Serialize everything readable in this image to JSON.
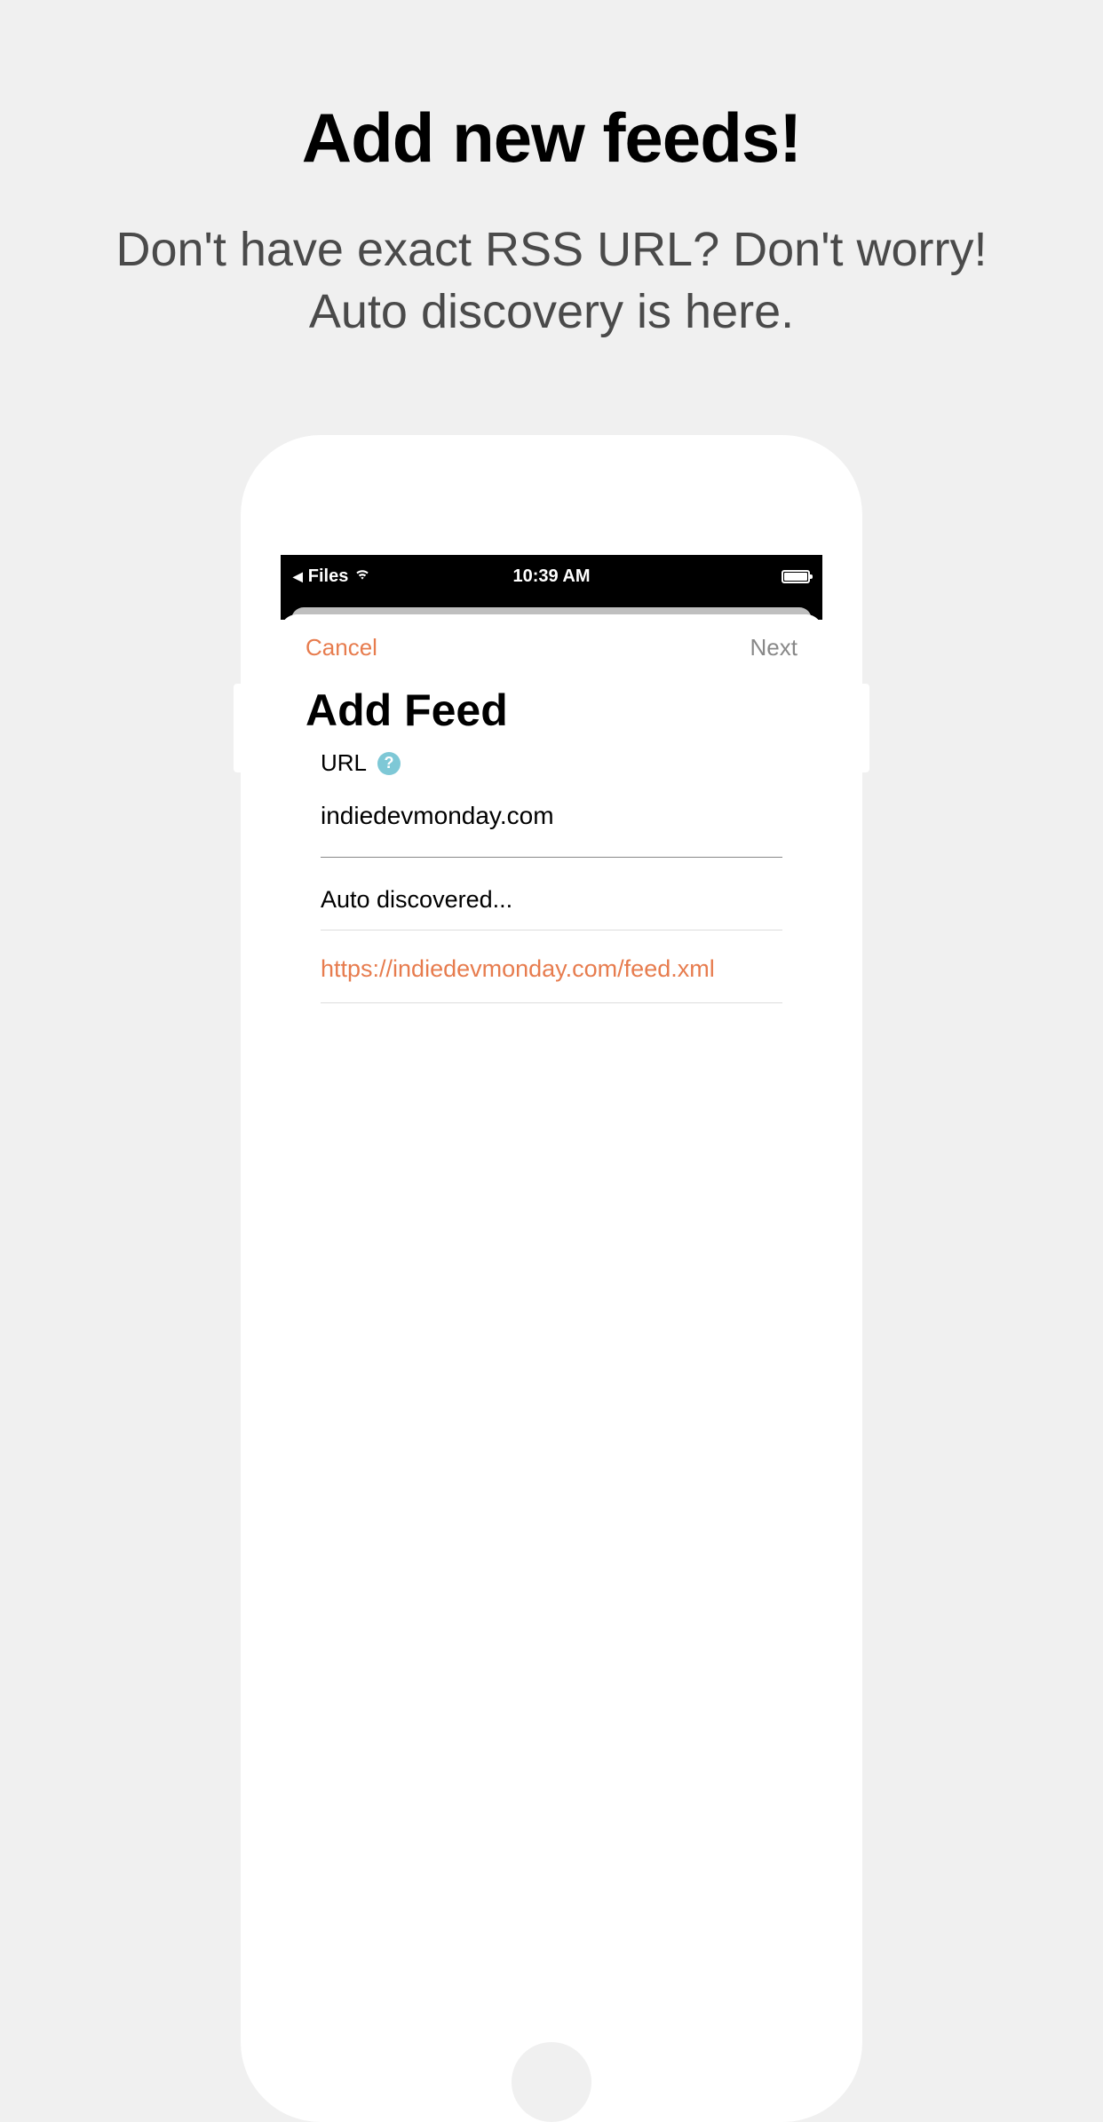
{
  "promo": {
    "title": "Add new feeds!",
    "subtitle": "Don't have exact RSS URL? Don't worry! Auto discovery is here."
  },
  "statusBar": {
    "backApp": "Files",
    "time": "10:39 AM"
  },
  "modal": {
    "cancelLabel": "Cancel",
    "nextLabel": "Next",
    "title": "Add Feed",
    "urlLabel": "URL",
    "helpSymbol": "?",
    "urlValue": "indiedevmonday.com",
    "discoveredHeader": "Auto discovered...",
    "discoveredItems": [
      "https://indiedevmonday.com/feed.xml"
    ]
  }
}
